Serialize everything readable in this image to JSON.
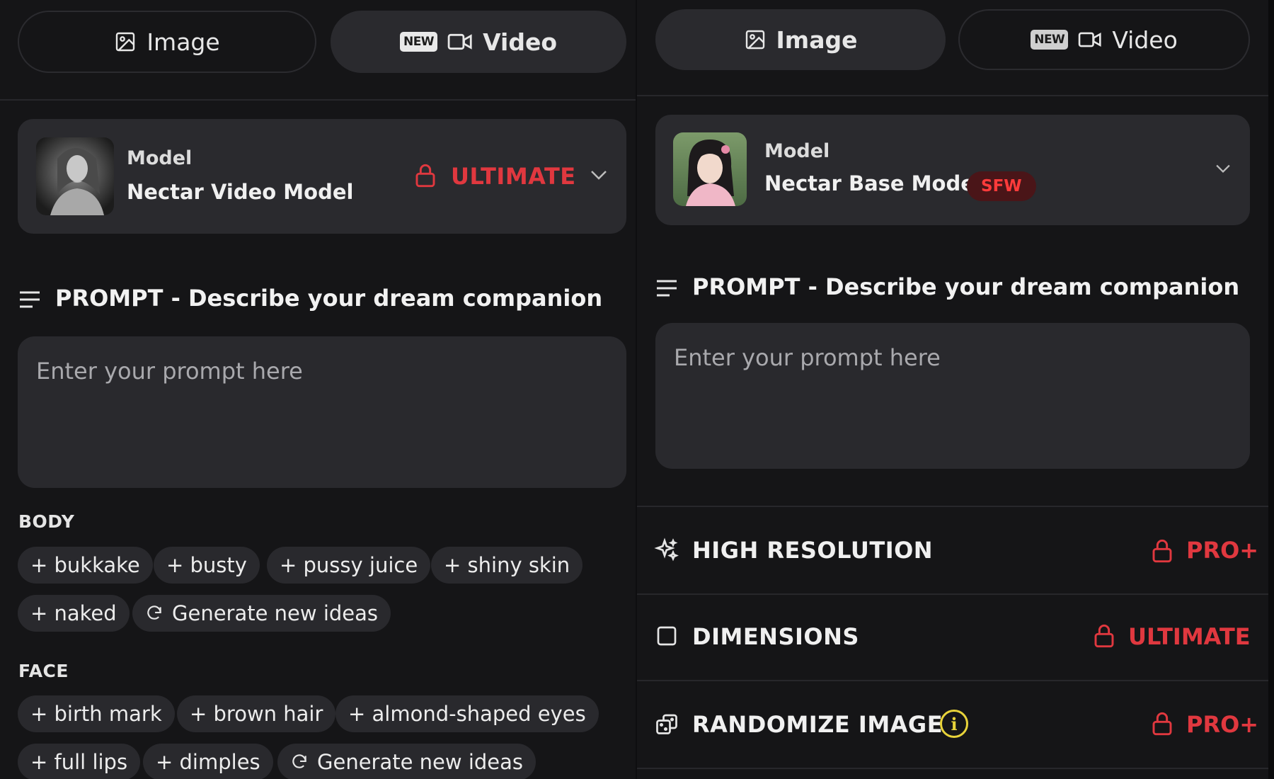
{
  "left": {
    "tabs": [
      {
        "label": "Image",
        "active": false,
        "icon": "image-icon"
      },
      {
        "label": "Video",
        "active": true,
        "icon": "video-camera-icon",
        "badge": "NEW"
      }
    ],
    "model": {
      "caption": "Model",
      "name": "Nectar Video Model",
      "tier": "ULTIMATE"
    },
    "prompt": {
      "title": "PROMPT - Describe your dream companion",
      "placeholder": "Enter your prompt here"
    },
    "body": {
      "label": "BODY",
      "chips": [
        "+ bukkake",
        "+ busty",
        "+ pussy juice",
        "+ shiny skin",
        "+ naked"
      ],
      "generate": "Generate new ideas"
    },
    "face": {
      "label": "FACE",
      "chips": [
        "+ birth mark",
        "+ brown hair",
        "+ almond-shaped eyes",
        "+ full lips",
        "+ dimples"
      ],
      "generate": "Generate new ideas"
    }
  },
  "right": {
    "tabs": [
      {
        "label": "Image",
        "active": true,
        "icon": "image-icon"
      },
      {
        "label": "Video",
        "active": false,
        "icon": "video-camera-icon",
        "badge": "NEW"
      }
    ],
    "model": {
      "caption": "Model",
      "name": "Nectar Base Model",
      "badge": "SFW"
    },
    "prompt": {
      "title": "PROMPT - Describe your dream companion",
      "placeholder": "Enter your prompt here"
    },
    "options": [
      {
        "label": "HIGH RESOLUTION",
        "tier": "PRO+",
        "icon": "sparkles-icon"
      },
      {
        "label": "DIMENSIONS",
        "tier": "ULTIMATE",
        "icon": "square-icon"
      },
      {
        "label": "RANDOMIZE IMAGE",
        "tier": "PRO+",
        "icon": "dice-icon",
        "info": "i"
      }
    ]
  },
  "colors": {
    "accent_red": "#e0383f",
    "background": "#151517",
    "surface": "#2a2a2e",
    "info_yellow": "#e8d33a"
  }
}
